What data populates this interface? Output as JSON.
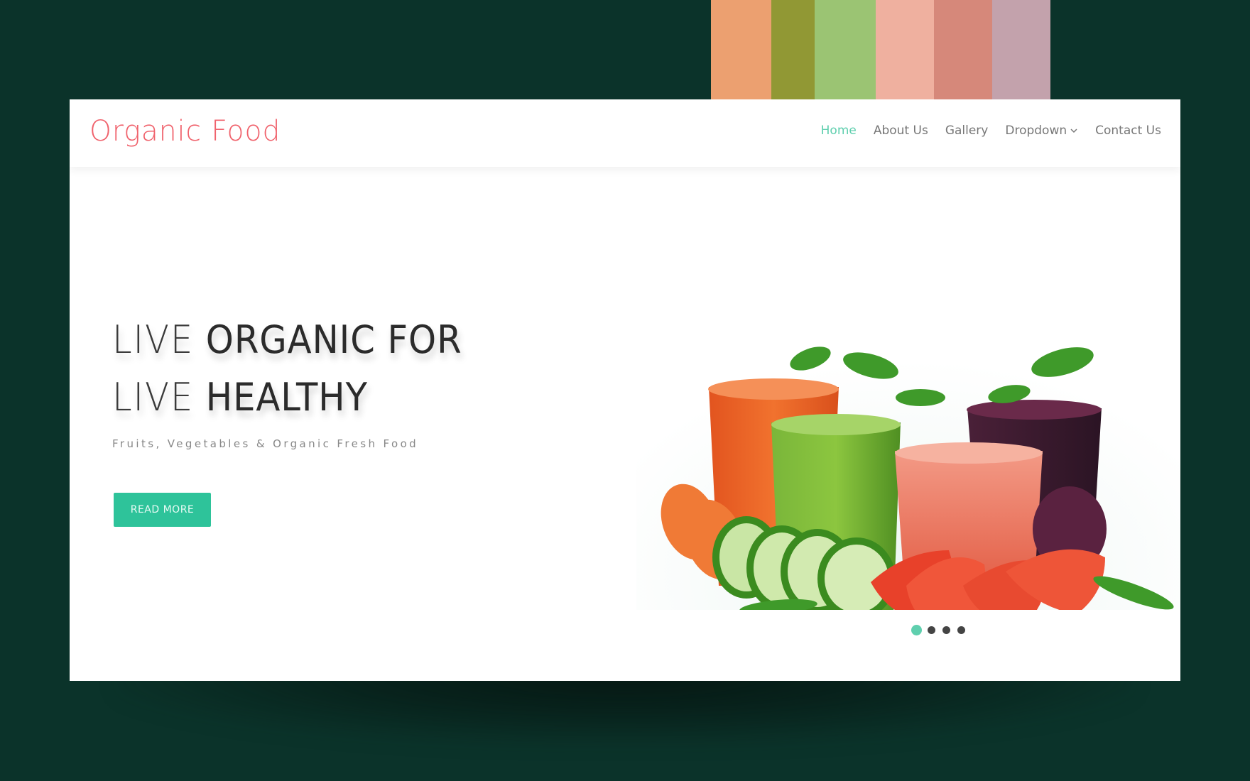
{
  "palette": {
    "swatches": [
      {
        "name": "peach",
        "color": "#eca070"
      },
      {
        "name": "olive",
        "color": "#919834"
      },
      {
        "name": "light-green",
        "color": "#9bc473"
      },
      {
        "name": "salmon-light",
        "color": "#efb09f"
      },
      {
        "name": "salmon",
        "color": "#d6887a"
      },
      {
        "name": "mauve",
        "color": "#c3a2ac"
      }
    ]
  },
  "header": {
    "logo": "Organic Food",
    "nav": [
      {
        "label": "Home",
        "active": true
      },
      {
        "label": "About Us",
        "active": false
      },
      {
        "label": "Gallery",
        "active": false
      },
      {
        "label": "Dropdown",
        "active": false,
        "icon": "chevron-down-icon"
      },
      {
        "label": "Contact Us",
        "active": false
      }
    ]
  },
  "hero": {
    "line1_light": "LIVE",
    "line1_bold": "ORGANIC FOR",
    "line2_light": "LIVE",
    "line2_bold": "HEALTHY",
    "subtitle": "Fruits, Vegetables & Organic Fresh Food",
    "button_label": "READ MORE",
    "image_alt": "Vegetable juices with cucumber, carrot, tomato and beetroot"
  },
  "carousel": {
    "slide_count": 4,
    "active_index": 0
  },
  "colors": {
    "accent": "#2ec39a",
    "nav_active": "#5fcfae",
    "logo": "#f0626c",
    "background": "#0b332a"
  }
}
